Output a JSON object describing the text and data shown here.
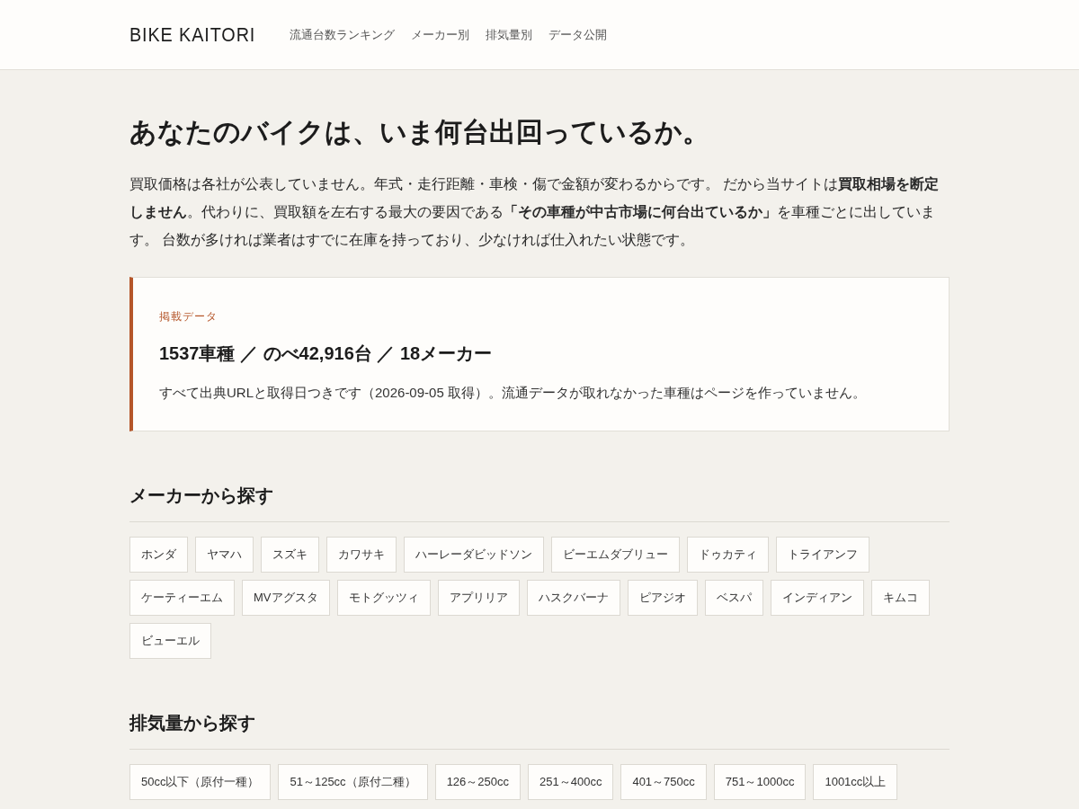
{
  "header": {
    "logo": "BIKE KAITORI",
    "nav": [
      "流通台数ランキング",
      "メーカー別",
      "排気量別",
      "データ公開"
    ]
  },
  "hero": {
    "title": "あなたのバイクは、いま何台出回っているか。",
    "paragraph": "買取価格は各社が公表していません。年式・走行距離・車検・傷で金額が変わるからです。 だから当サイトは**買取相場を断定しません**。代わりに、買取額を左右する最大の要因である**「その車種が中古市場に何台出ているか」**を車種ごとに出しています。 台数が多ければ業者はすでに在庫を持っており、少なければ仕入れたい状態です。"
  },
  "data_card": {
    "label": "掲載データ",
    "stats": "1537車種 ／ のべ42,916台 ／ 18メーカー",
    "note": "すべて出典URLと取得日つきです（2026-09-05 取得）。流通データが取れなかった車種はページを作っていません。"
  },
  "sections": [
    {
      "heading": "メーカーから探す",
      "links": [
        "ホンダ",
        "ヤマハ",
        "スズキ",
        "カワサキ",
        "ハーレーダビッドソン",
        "ビーエムダブリュー",
        "ドゥカティ",
        "トライアンフ",
        "ケーティーエム",
        "MVアグスタ",
        "モトグッツィ",
        "アプリリア",
        "ハスクバーナ",
        "ピアジオ",
        "ベスパ",
        "インディアン",
        "キムコ",
        "ビューエル"
      ]
    },
    {
      "heading": "排気量から探す",
      "links": [
        "50cc以下（原付一種）",
        "51～125cc（原付二種）",
        "126～250cc",
        "251～400cc",
        "401～750cc",
        "751～1000cc",
        "1001cc以上"
      ]
    }
  ]
}
